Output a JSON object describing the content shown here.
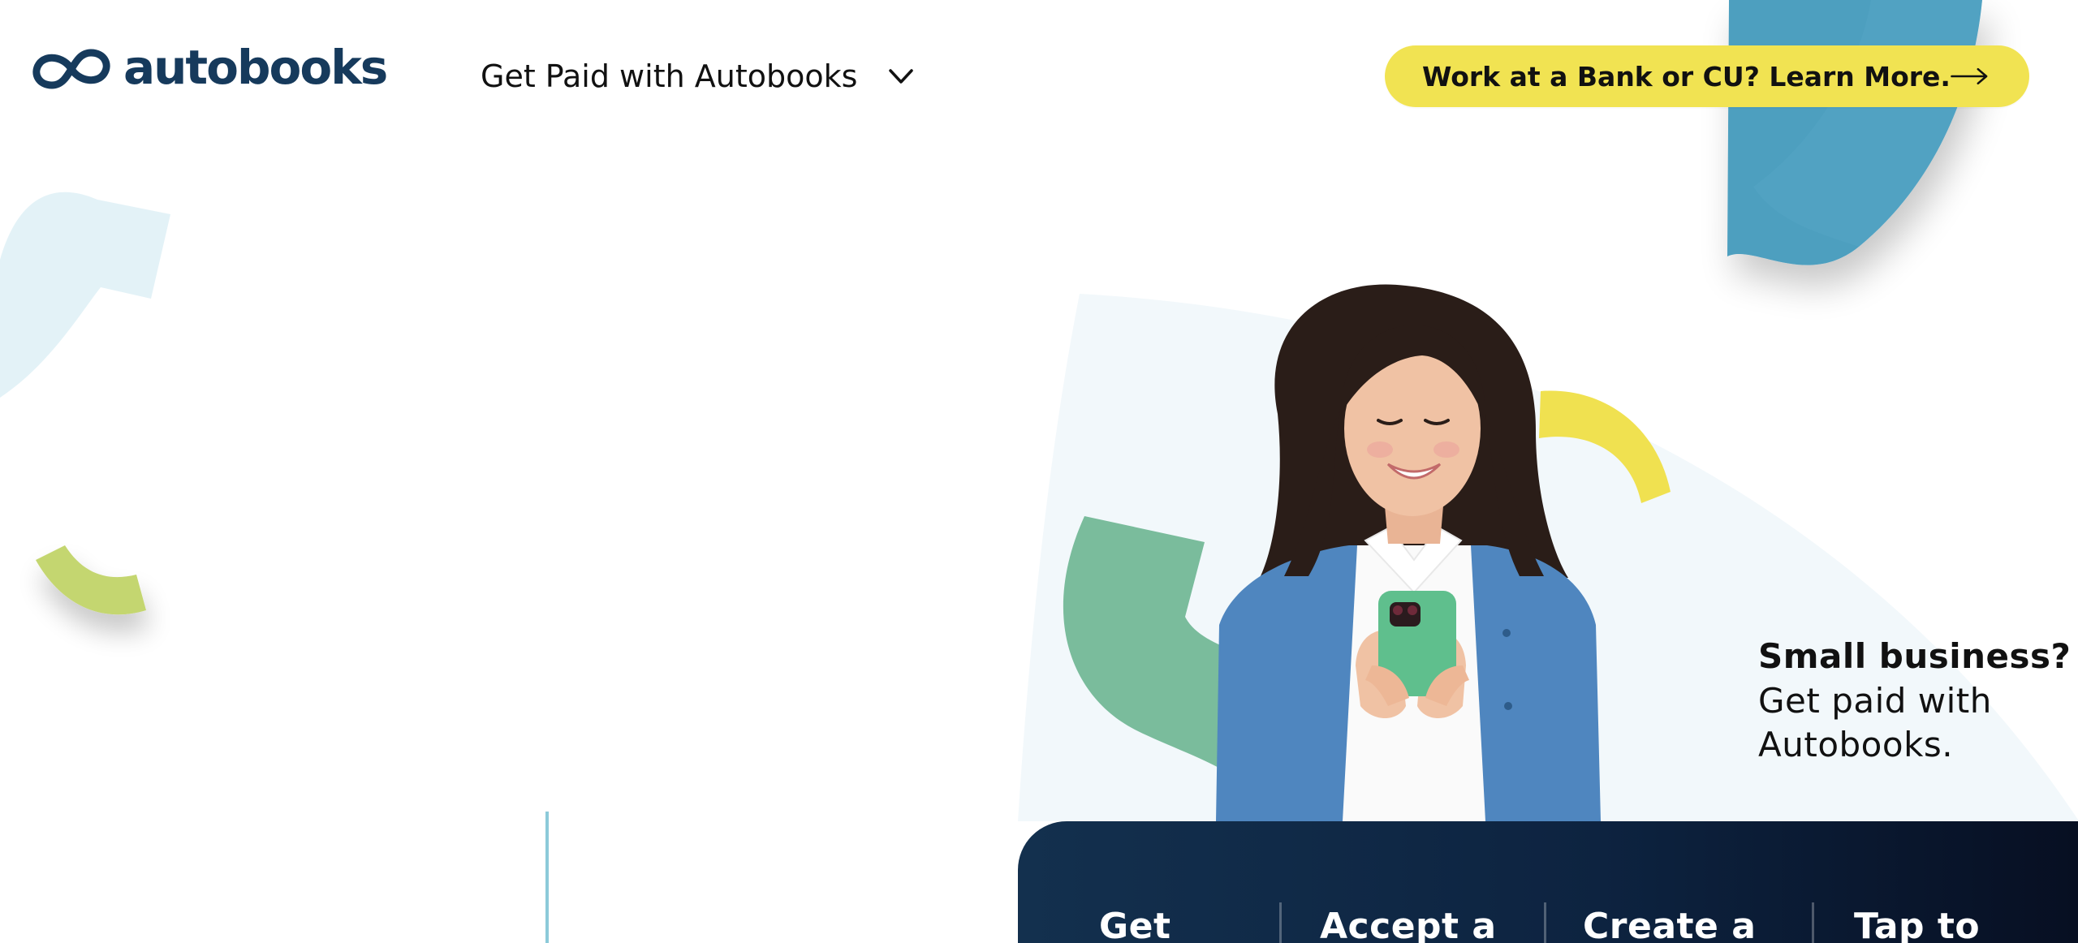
{
  "brand": {
    "name": "autobooks",
    "colors": {
      "navy": "#163A5C",
      "accent_yellow": "#F1E352",
      "teal": "#4E9FBF",
      "light_blue": "#E3F2F7",
      "lime": "#C4D66F",
      "green": "#5FAF86",
      "panel_navy": "#13304E"
    }
  },
  "header": {
    "nav_dropdown": {
      "label": "Get Paid with Autobooks",
      "icon": "chevron-down-icon"
    },
    "cta": {
      "label": "Work at a Bank or CU? Learn More.",
      "icon": "arrow-right-icon"
    }
  },
  "hero": {
    "headline": "Small business?",
    "subline": "Get paid with Autobooks.",
    "photo_alt": "Smiling woman holding a green phone"
  },
  "feature_panel": {
    "tabs": [
      {
        "label": "Get"
      },
      {
        "label": "Accept a"
      },
      {
        "label": "Create a"
      },
      {
        "label": "Tap to"
      }
    ]
  }
}
